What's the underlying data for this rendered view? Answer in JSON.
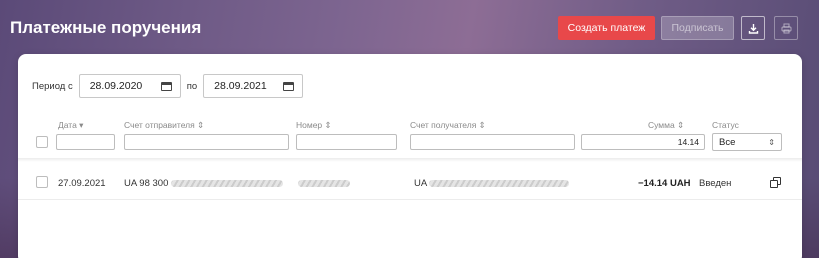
{
  "header": {
    "title": "Платежные поручения",
    "create_label": "Создать платеж",
    "sign_label": "Подписать",
    "download_icon": "download-icon",
    "print_icon": "print-icon"
  },
  "filters": {
    "period_label": "Период с",
    "date_from": "28.09.2020",
    "to_label": "по",
    "date_to": "28.09.2021"
  },
  "table": {
    "columns": {
      "date": "Дата ▾",
      "sender_account": "Счет отправителя ⇕",
      "number": "Номер ⇕",
      "recipient_account": "Счет получателя ⇕",
      "amount": "Сумма ⇕",
      "status": "Статус"
    },
    "filter_values": {
      "amount": "14.14",
      "status": "Все"
    },
    "rows": [
      {
        "date": "27.09.2021",
        "sender_account": "UA 98 300",
        "recipient_account": "UA",
        "amount": "−14.14 UAH",
        "status": "Введен"
      }
    ]
  },
  "colors": {
    "accent": "#e8484a"
  }
}
